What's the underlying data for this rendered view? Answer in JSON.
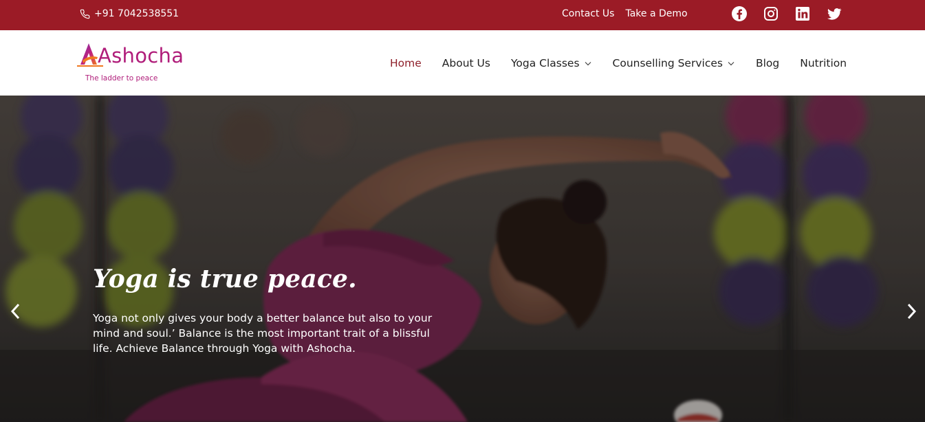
{
  "topbar": {
    "phone": "+91 7042538551",
    "links": [
      "Contact Us",
      "Take a Demo"
    ],
    "social_icons": [
      "facebook-icon",
      "instagram-icon",
      "linkedin-icon",
      "twitter-icon"
    ],
    "bg_color": "#9b1b26"
  },
  "logo": {
    "name": "Ashocha",
    "tagline": "The ladder to peace"
  },
  "nav": {
    "items": [
      {
        "label": "Home",
        "active": true
      },
      {
        "label": "About Us"
      },
      {
        "label": "Yoga Classes",
        "dropdown": true
      },
      {
        "label": "Counselling Services",
        "dropdown": true
      },
      {
        "label": "Blog"
      },
      {
        "label": "Nutrition"
      }
    ]
  },
  "hero": {
    "title": "Yoga is true peace.",
    "description": "Yoga not only gives your body a better balance but also to your mind and soul.’ Balance is the most important trait of a blissful life. Achieve Balance through Yoga with Ashocha."
  },
  "colors": {
    "brand": "#b01d7a",
    "accent": "#9b1b26",
    "active_nav": "#8e1f2a"
  }
}
